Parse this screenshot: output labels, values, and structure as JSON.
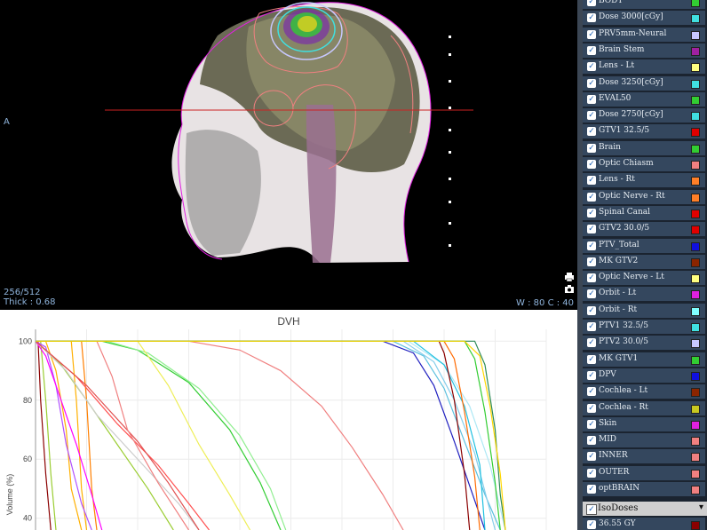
{
  "viewer": {
    "orientation_label": "A",
    "slice_label": "256/512",
    "thickness_label": "Thick : 0.68",
    "window_label": "W : 80 C : 40",
    "print_icon": "printer-icon",
    "camera_icon": "camera-icon"
  },
  "dvh": {
    "title": "DVH",
    "ylabel": "Volume (%)"
  },
  "chart_data": {
    "type": "line",
    "title": "DVH",
    "xlabel": "",
    "ylabel": "Volume (%)",
    "ylim": [
      36,
      104
    ],
    "xlim": [
      0,
      100
    ],
    "y_ticks": [
      100,
      80,
      60,
      40
    ],
    "grid": true,
    "series": [
      {
        "color": "#ffb000",
        "x": [
          0,
          2,
          4,
          6,
          7,
          9
        ],
        "y": [
          100,
          100,
          90,
          70,
          50,
          36
        ]
      },
      {
        "color": "#ffb000",
        "x": [
          0,
          7,
          8,
          9,
          10
        ],
        "y": [
          100,
          100,
          80,
          50,
          36
        ]
      },
      {
        "color": "#ff7f00",
        "x": [
          0,
          9,
          10,
          11,
          12
        ],
        "y": [
          100,
          100,
          80,
          50,
          36
        ]
      },
      {
        "color": "#9acd32",
        "x": [
          0,
          1,
          2,
          3,
          4
        ],
        "y": [
          100,
          100,
          80,
          55,
          36
        ]
      },
      {
        "color": "#8b0000",
        "x": [
          0,
          0.5,
          1,
          2,
          3
        ],
        "y": [
          100,
          100,
          80,
          55,
          36
        ]
      },
      {
        "color": "#b050ff",
        "x": [
          0,
          2,
          4,
          6,
          9,
          11
        ],
        "y": [
          100,
          98,
          85,
          65,
          45,
          36
        ]
      },
      {
        "color": "#ff00ff",
        "x": [
          0,
          2,
          5,
          8,
          11,
          13
        ],
        "y": [
          100,
          95,
          80,
          65,
          48,
          36
        ]
      },
      {
        "color": "#9acd32",
        "x": [
          0,
          5,
          10,
          16,
          22,
          27
        ],
        "y": [
          100,
          92,
          80,
          65,
          50,
          36
        ]
      },
      {
        "color": "#cccccc",
        "x": [
          0,
          6,
          12,
          20,
          28,
          32
        ],
        "y": [
          100,
          90,
          75,
          60,
          45,
          36
        ]
      },
      {
        "color": "#ff5050",
        "x": [
          0,
          8,
          16,
          24,
          30,
          34
        ],
        "y": [
          100,
          88,
          72,
          58,
          45,
          36
        ]
      },
      {
        "color": "#e05050",
        "x": [
          0,
          10,
          20,
          26,
          32
        ],
        "y": [
          100,
          85,
          66,
          52,
          36
        ]
      },
      {
        "color": "#f08080",
        "x": [
          0,
          12,
          14,
          15,
          18,
          24,
          30
        ],
        "y": [
          100,
          100,
          92,
          88,
          70,
          52,
          36
        ]
      },
      {
        "color": "#32cd32",
        "x": [
          0,
          13,
          20,
          30,
          38,
          44,
          48
        ],
        "y": [
          100,
          100,
          97,
          86,
          70,
          52,
          36
        ]
      },
      {
        "color": "#90ee90",
        "x": [
          0,
          14,
          22,
          32,
          40,
          46,
          49
        ],
        "y": [
          100,
          100,
          96,
          84,
          68,
          50,
          36
        ]
      },
      {
        "color": "#eeee55",
        "x": [
          0,
          20,
          26,
          32,
          38,
          42
        ],
        "y": [
          100,
          100,
          85,
          65,
          48,
          36
        ]
      },
      {
        "color": "#f08080",
        "x": [
          0,
          30,
          40,
          48,
          56,
          62,
          68,
          72
        ],
        "y": [
          100,
          100,
          97,
          90,
          78,
          64,
          48,
          36
        ]
      },
      {
        "color": "#1f1fbf",
        "x": [
          0,
          68,
          74,
          78,
          82,
          86,
          88
        ],
        "y": [
          100,
          100,
          96,
          85,
          66,
          46,
          36
        ]
      },
      {
        "color": "#5bc0de",
        "x": [
          0,
          70,
          76,
          80,
          84,
          88,
          91
        ],
        "y": [
          100,
          100,
          95,
          84,
          66,
          48,
          36
        ]
      },
      {
        "color": "#87ceeb",
        "x": [
          0,
          72,
          78,
          82,
          86,
          90
        ],
        "y": [
          100,
          100,
          93,
          80,
          62,
          36
        ]
      },
      {
        "color": "#aee8f5",
        "x": [
          0,
          73,
          80,
          85,
          89,
          92
        ],
        "y": [
          100,
          100,
          92,
          78,
          58,
          36
        ]
      },
      {
        "color": "#20c0e0",
        "x": [
          0,
          74,
          80,
          84,
          87,
          88
        ],
        "y": [
          100,
          100,
          92,
          78,
          58,
          36
        ]
      },
      {
        "color": "#8b0000",
        "x": [
          0,
          79,
          80,
          82,
          84,
          85
        ],
        "y": [
          100,
          100,
          96,
          80,
          55,
          36
        ]
      },
      {
        "color": "#ff6a00",
        "x": [
          0,
          80,
          82,
          84,
          86,
          87
        ],
        "y": [
          100,
          100,
          94,
          76,
          54,
          36
        ]
      },
      {
        "color": "#32cd32",
        "x": [
          0,
          84,
          86,
          88,
          90,
          91
        ],
        "y": [
          100,
          100,
          94,
          76,
          52,
          36
        ]
      },
      {
        "color": "#2e8b57",
        "x": [
          0,
          86,
          88,
          90,
          91,
          92
        ],
        "y": [
          100,
          100,
          92,
          70,
          48,
          36
        ]
      },
      {
        "color": "#ffd700",
        "x": [
          0,
          84,
          87,
          89,
          91,
          92
        ],
        "y": [
          100,
          100,
          95,
          78,
          55,
          36
        ]
      }
    ]
  },
  "structures": [
    {
      "label": "BODY",
      "color": "#32cd32"
    },
    {
      "label": "Dose 3000[cGy]",
      "color": "#40e0e0"
    },
    {
      "label": "PRV5mm-Neural",
      "color": "#c8c8ff"
    },
    {
      "label": "Brain Stem",
      "color": "#a020a0"
    },
    {
      "label": "Lens - Lt",
      "color": "#ffff80"
    },
    {
      "label": "Dose 3250[cGy]",
      "color": "#40e0e0"
    },
    {
      "label": "EVAL50",
      "color": "#32cd32"
    },
    {
      "label": "Dose 2750[cGy]",
      "color": "#40e0e0"
    },
    {
      "label": "GTV1 32.5/5",
      "color": "#e00000"
    },
    {
      "label": "Brain",
      "color": "#32cd32"
    },
    {
      "label": "Optic Chiasm",
      "color": "#f08080"
    },
    {
      "label": "Lens - Rt",
      "color": "#ff7f27"
    },
    {
      "label": "Optic Nerve - Rt",
      "color": "#ff7f27"
    },
    {
      "label": "Spinal Canal",
      "color": "#e00000"
    },
    {
      "label": "GTV2 30.0/5",
      "color": "#e00000"
    },
    {
      "label": "PTV_Total",
      "color": "#1010e0"
    },
    {
      "label": "MK GTV2",
      "color": "#8b2500"
    },
    {
      "label": "Optic Nerve - Lt",
      "color": "#ffff80"
    },
    {
      "label": "Orbit - Lt",
      "color": "#e020e0"
    },
    {
      "label": "Orbit - Rt",
      "color": "#80ffff"
    },
    {
      "label": "PTV1 32.5/5",
      "color": "#40e0e0"
    },
    {
      "label": "PTV2 30.0/5",
      "color": "#c8c8ff"
    },
    {
      "label": "MK GTV1",
      "color": "#32cd32"
    },
    {
      "label": "DPV",
      "color": "#1010e0"
    },
    {
      "label": "Cochlea - Lt",
      "color": "#8b2500"
    },
    {
      "label": "Cochlea - Rt",
      "color": "#c8c820"
    },
    {
      "label": "Skin",
      "color": "#e020e0"
    },
    {
      "label": "MID",
      "color": "#f08080"
    },
    {
      "label": "INNER",
      "color": "#f08080"
    },
    {
      "label": "OUTER",
      "color": "#f08080"
    },
    {
      "label": "optBRAIN",
      "color": "#f08080"
    }
  ],
  "isodoses": {
    "header_label": "IsoDoses",
    "items": [
      {
        "label": "36.55 GY",
        "color": "#8b0000"
      }
    ]
  }
}
